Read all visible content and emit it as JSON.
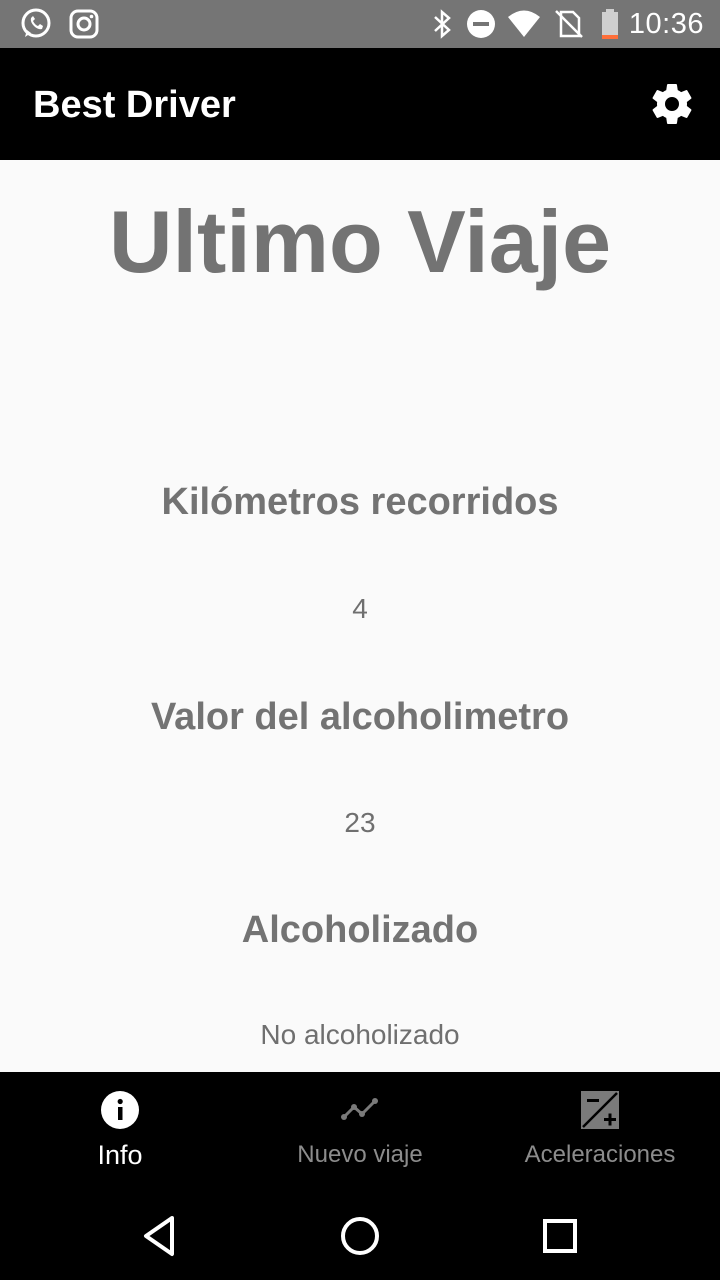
{
  "status_bar": {
    "time": "10:36",
    "left_icons": [
      "whatsapp-icon",
      "instagram-icon"
    ],
    "right_icons": [
      "bluetooth-icon",
      "do-not-disturb-icon",
      "wifi-icon",
      "no-sim-icon",
      "battery-icon"
    ]
  },
  "app_bar": {
    "title": "Best Driver",
    "settings_icon": "gear-icon"
  },
  "main": {
    "heading": "Ultimo Viaje",
    "fields": [
      {
        "label": "Kilómetros recorridos",
        "value": "4"
      },
      {
        "label": "Valor del alcoholimetro",
        "value": "23"
      },
      {
        "label": "Alcoholizado",
        "value": "No alcoholizado"
      }
    ]
  },
  "bottom_nav": {
    "items": [
      {
        "label": "Info",
        "icon": "info-icon",
        "active": true
      },
      {
        "label": "Nuevo viaje",
        "icon": "timeline-icon",
        "active": false
      },
      {
        "label": "Aceleraciones",
        "icon": "exposure-icon",
        "active": false
      }
    ]
  },
  "system_nav": {
    "icons": [
      "back-icon",
      "home-icon",
      "recents-icon"
    ]
  },
  "colors": {
    "status_bar": "#757575",
    "app_bar": "#000000",
    "background": "#fafafa",
    "text_gray": "#737373",
    "nav_inactive": "#8c8c8c"
  }
}
